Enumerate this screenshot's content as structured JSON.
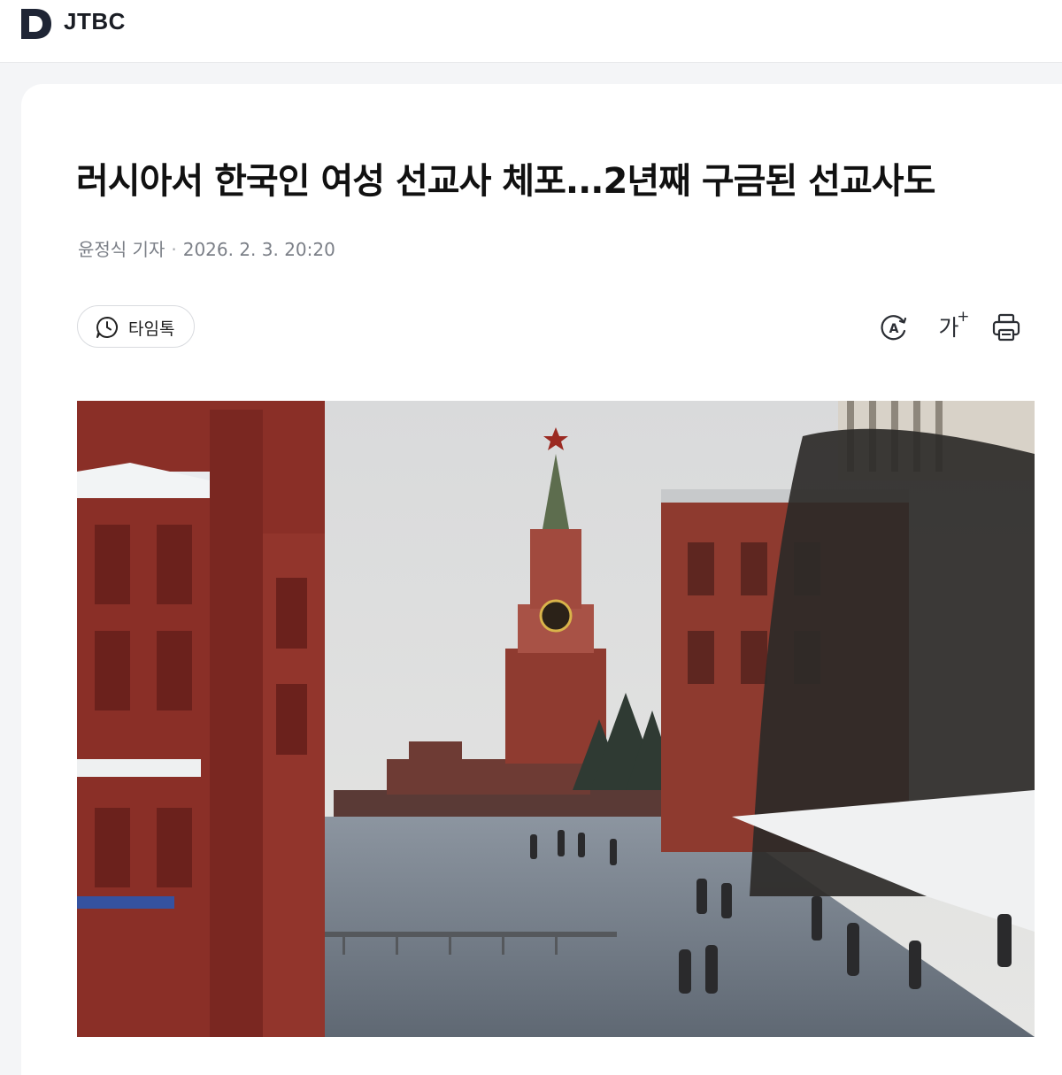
{
  "header": {
    "logo_letter": "D",
    "brand": "JTBC"
  },
  "article": {
    "headline": "러시아서 한국인 여성 선교사 체포...2년째 구금된 선교사도",
    "reporter": "윤정식 기자",
    "separator": "·",
    "datetime": "2026. 2. 3. 20:20",
    "timetalk_label": "타임톡",
    "font_size_label": "가",
    "font_size_plus": "+"
  },
  "toolbar": {
    "icons": [
      "translate-icon",
      "font-size-icon",
      "print-icon"
    ]
  },
  "photo": {
    "subject": "Moscow Red Square with Spasskaya Tower in winter"
  },
  "colors": {
    "brand_dark": "#1f2535",
    "page_bg": "#f4f5f7",
    "card_bg": "#ffffff",
    "meta_text": "#7b7f87"
  }
}
